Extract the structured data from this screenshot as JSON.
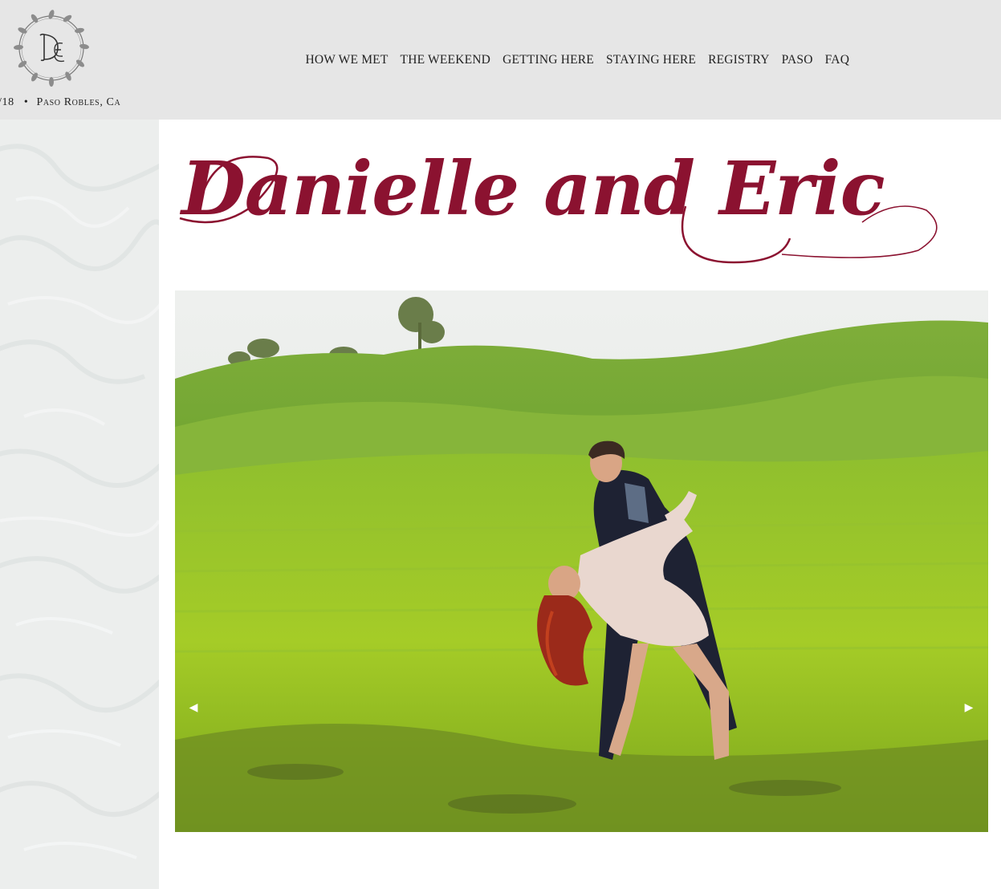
{
  "header": {
    "logo_alt": "D E monogram wreath",
    "tagline_date": "/18",
    "tagline_separator": "•",
    "tagline_location": "Paso Robles, Ca"
  },
  "nav": {
    "items": [
      {
        "label": "HOW WE MET"
      },
      {
        "label": "THE WEEKEND"
      },
      {
        "label": "GETTING HERE"
      },
      {
        "label": "STAYING HERE"
      },
      {
        "label": "REGISTRY"
      },
      {
        "label": "PASO"
      },
      {
        "label": "FAQ"
      }
    ]
  },
  "main": {
    "title": "Danielle and Eric"
  },
  "slideshow": {
    "prev_icon": "triangle-left",
    "next_icon": "triangle-right",
    "prev_glyph": "◀",
    "next_glyph": "▶"
  },
  "colors": {
    "header_bg": "#e6e6e6",
    "title": "#8b1230",
    "nav_text": "#222222",
    "side_panel": "#eceeed"
  }
}
